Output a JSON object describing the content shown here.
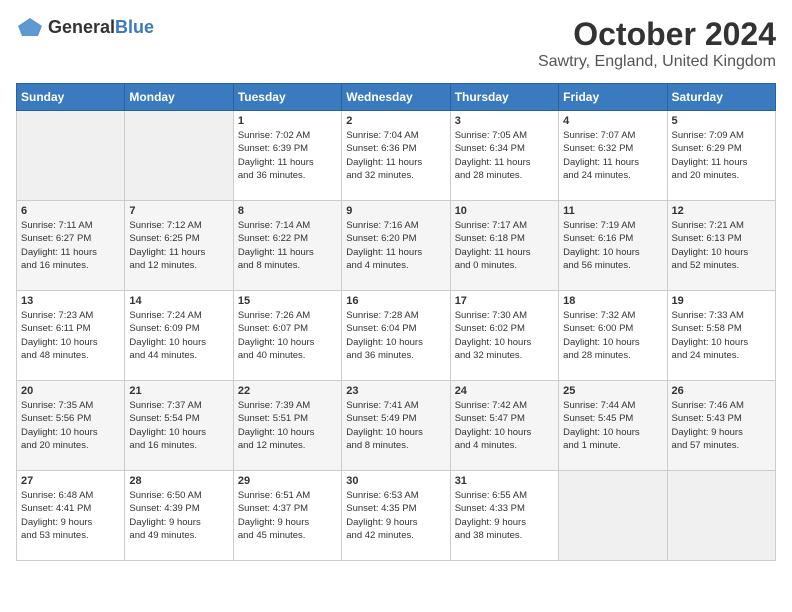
{
  "header": {
    "logo": {
      "general": "General",
      "blue": "Blue"
    },
    "title": "October 2024",
    "subtitle": "Sawtry, England, United Kingdom"
  },
  "days_of_week": [
    "Sunday",
    "Monday",
    "Tuesday",
    "Wednesday",
    "Thursday",
    "Friday",
    "Saturday"
  ],
  "weeks": [
    [
      {
        "day": "",
        "info": ""
      },
      {
        "day": "",
        "info": ""
      },
      {
        "day": "1",
        "info": "Sunrise: 7:02 AM\nSunset: 6:39 PM\nDaylight: 11 hours\nand 36 minutes."
      },
      {
        "day": "2",
        "info": "Sunrise: 7:04 AM\nSunset: 6:36 PM\nDaylight: 11 hours\nand 32 minutes."
      },
      {
        "day": "3",
        "info": "Sunrise: 7:05 AM\nSunset: 6:34 PM\nDaylight: 11 hours\nand 28 minutes."
      },
      {
        "day": "4",
        "info": "Sunrise: 7:07 AM\nSunset: 6:32 PM\nDaylight: 11 hours\nand 24 minutes."
      },
      {
        "day": "5",
        "info": "Sunrise: 7:09 AM\nSunset: 6:29 PM\nDaylight: 11 hours\nand 20 minutes."
      }
    ],
    [
      {
        "day": "6",
        "info": "Sunrise: 7:11 AM\nSunset: 6:27 PM\nDaylight: 11 hours\nand 16 minutes."
      },
      {
        "day": "7",
        "info": "Sunrise: 7:12 AM\nSunset: 6:25 PM\nDaylight: 11 hours\nand 12 minutes."
      },
      {
        "day": "8",
        "info": "Sunrise: 7:14 AM\nSunset: 6:22 PM\nDaylight: 11 hours\nand 8 minutes."
      },
      {
        "day": "9",
        "info": "Sunrise: 7:16 AM\nSunset: 6:20 PM\nDaylight: 11 hours\nand 4 minutes."
      },
      {
        "day": "10",
        "info": "Sunrise: 7:17 AM\nSunset: 6:18 PM\nDaylight: 11 hours\nand 0 minutes."
      },
      {
        "day": "11",
        "info": "Sunrise: 7:19 AM\nSunset: 6:16 PM\nDaylight: 10 hours\nand 56 minutes."
      },
      {
        "day": "12",
        "info": "Sunrise: 7:21 AM\nSunset: 6:13 PM\nDaylight: 10 hours\nand 52 minutes."
      }
    ],
    [
      {
        "day": "13",
        "info": "Sunrise: 7:23 AM\nSunset: 6:11 PM\nDaylight: 10 hours\nand 48 minutes."
      },
      {
        "day": "14",
        "info": "Sunrise: 7:24 AM\nSunset: 6:09 PM\nDaylight: 10 hours\nand 44 minutes."
      },
      {
        "day": "15",
        "info": "Sunrise: 7:26 AM\nSunset: 6:07 PM\nDaylight: 10 hours\nand 40 minutes."
      },
      {
        "day": "16",
        "info": "Sunrise: 7:28 AM\nSunset: 6:04 PM\nDaylight: 10 hours\nand 36 minutes."
      },
      {
        "day": "17",
        "info": "Sunrise: 7:30 AM\nSunset: 6:02 PM\nDaylight: 10 hours\nand 32 minutes."
      },
      {
        "day": "18",
        "info": "Sunrise: 7:32 AM\nSunset: 6:00 PM\nDaylight: 10 hours\nand 28 minutes."
      },
      {
        "day": "19",
        "info": "Sunrise: 7:33 AM\nSunset: 5:58 PM\nDaylight: 10 hours\nand 24 minutes."
      }
    ],
    [
      {
        "day": "20",
        "info": "Sunrise: 7:35 AM\nSunset: 5:56 PM\nDaylight: 10 hours\nand 20 minutes."
      },
      {
        "day": "21",
        "info": "Sunrise: 7:37 AM\nSunset: 5:54 PM\nDaylight: 10 hours\nand 16 minutes."
      },
      {
        "day": "22",
        "info": "Sunrise: 7:39 AM\nSunset: 5:51 PM\nDaylight: 10 hours\nand 12 minutes."
      },
      {
        "day": "23",
        "info": "Sunrise: 7:41 AM\nSunset: 5:49 PM\nDaylight: 10 hours\nand 8 minutes."
      },
      {
        "day": "24",
        "info": "Sunrise: 7:42 AM\nSunset: 5:47 PM\nDaylight: 10 hours\nand 4 minutes."
      },
      {
        "day": "25",
        "info": "Sunrise: 7:44 AM\nSunset: 5:45 PM\nDaylight: 10 hours\nand 1 minute."
      },
      {
        "day": "26",
        "info": "Sunrise: 7:46 AM\nSunset: 5:43 PM\nDaylight: 9 hours\nand 57 minutes."
      }
    ],
    [
      {
        "day": "27",
        "info": "Sunrise: 6:48 AM\nSunset: 4:41 PM\nDaylight: 9 hours\nand 53 minutes."
      },
      {
        "day": "28",
        "info": "Sunrise: 6:50 AM\nSunset: 4:39 PM\nDaylight: 9 hours\nand 49 minutes."
      },
      {
        "day": "29",
        "info": "Sunrise: 6:51 AM\nSunset: 4:37 PM\nDaylight: 9 hours\nand 45 minutes."
      },
      {
        "day": "30",
        "info": "Sunrise: 6:53 AM\nSunset: 4:35 PM\nDaylight: 9 hours\nand 42 minutes."
      },
      {
        "day": "31",
        "info": "Sunrise: 6:55 AM\nSunset: 4:33 PM\nDaylight: 9 hours\nand 38 minutes."
      },
      {
        "day": "",
        "info": ""
      },
      {
        "day": "",
        "info": ""
      }
    ]
  ]
}
